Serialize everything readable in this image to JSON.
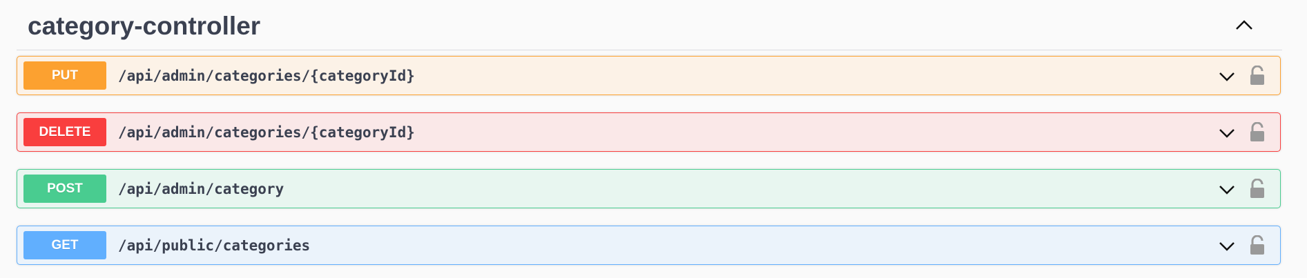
{
  "section": {
    "title": "category-controller",
    "collapse_icon": "chevron-up-icon"
  },
  "operations": [
    {
      "method": "PUT",
      "path": "/api/admin/categories/{categoryId}",
      "color": "#fca130",
      "bg": "#fcf2e7"
    },
    {
      "method": "DELETE",
      "path": "/api/admin/categories/{categoryId}",
      "color": "#f93e3e",
      "bg": "#fae8e8"
    },
    {
      "method": "POST",
      "path": "/api/admin/category",
      "color": "#49cc90",
      "bg": "#e8f6f0"
    },
    {
      "method": "GET",
      "path": "/api/public/categories",
      "color": "#61affe",
      "bg": "#ebf3fb"
    }
  ],
  "icons": {
    "expand": "chevron-down-icon",
    "lock": "unlocked-lock-icon"
  }
}
